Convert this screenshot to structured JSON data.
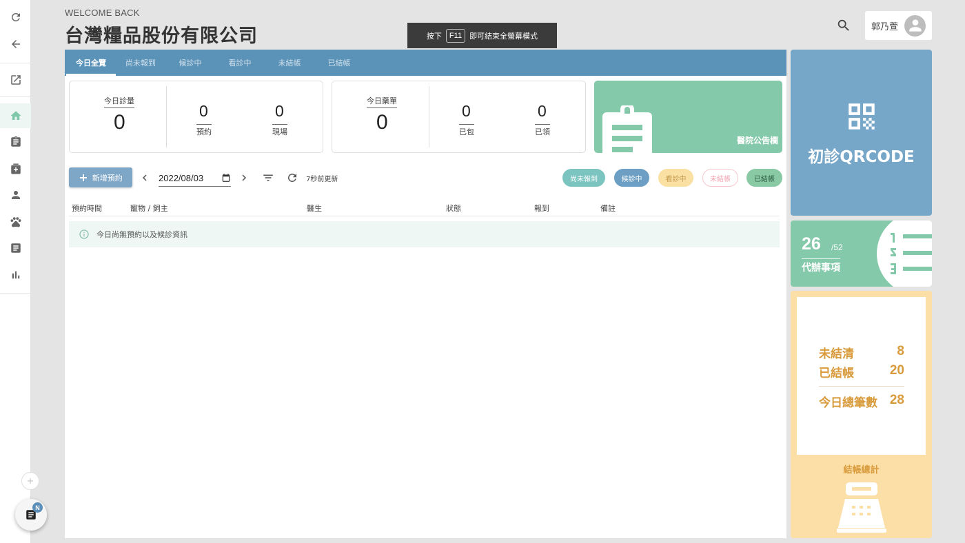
{
  "header": {
    "welcome": "WELCOME BACK",
    "company": "台灣糧品股份有限公司",
    "fullscreen_hint": {
      "before": "按下",
      "key": "F11",
      "after": "即可結束全螢幕模式"
    },
    "user_name": "郭乃萱"
  },
  "rail": {
    "icons": [
      "refresh-icon",
      "back-arrow-icon",
      "open-external-icon",
      "home-icon",
      "clipboard-icon",
      "add-record-icon",
      "person-icon",
      "paw-icon",
      "document-icon",
      "bar-chart-icon"
    ],
    "active": "home-icon",
    "fab_badge": "N"
  },
  "tabs": [
    {
      "label": "今日全覽",
      "active": true
    },
    {
      "label": "尚未報到",
      "active": false
    },
    {
      "label": "候診中",
      "active": false
    },
    {
      "label": "看診中",
      "active": false
    },
    {
      "label": "未結帳",
      "active": false
    },
    {
      "label": "已結帳",
      "active": false
    }
  ],
  "stats": {
    "visits": {
      "label": "今日診量",
      "value": "0",
      "booked_label": "預約",
      "booked": "0",
      "walkin_label": "現場",
      "walkin": "0"
    },
    "prescriptions": {
      "label": "今日藥單",
      "value": "0",
      "packed_label": "已包",
      "packed": "0",
      "picked_label": "已領",
      "picked": "0"
    }
  },
  "notice": {
    "label": "醫院公告欄"
  },
  "toolbar": {
    "add_label": "新增預約",
    "date": "2022/08/03",
    "refresh_text": "7秒前更新",
    "chips": [
      {
        "label": "尚未報到",
        "bg": "#7cc4c0",
        "color": "#ffffff",
        "border": "#7cc4c0"
      },
      {
        "label": "候診中",
        "bg": "#6c9fc3",
        "color": "#ffffff",
        "border": "#6c9fc3"
      },
      {
        "label": "看診中",
        "bg": "#fbe0a4",
        "color": "#c49a4c",
        "border": "#fbe0a4"
      },
      {
        "label": "未結帳",
        "bg": "#ffffff",
        "color": "#f2a6b1",
        "border": "#f5c8cf"
      },
      {
        "label": "已結帳",
        "bg": "#89c9a4",
        "color": "#2f5f45",
        "border": "#89c9a4"
      }
    ]
  },
  "table": {
    "columns": [
      "預約時間",
      "寵物 / 飼主",
      "醫生",
      "狀態",
      "報到",
      "備註"
    ],
    "empty_message": "今日尚無預約以及候診資訊"
  },
  "qr": {
    "label": "初診QRCODE"
  },
  "todo": {
    "count": "26",
    "total": "/52",
    "label": "代辦事項"
  },
  "billing": {
    "unsettled_label": "未結清",
    "unsettled": "8",
    "settled_label": "已結帳",
    "settled": "20",
    "total_label": "今日總筆數",
    "total": "28",
    "title": "結帳總計"
  },
  "colors": {
    "accent_blue": "#5b92b8",
    "accent_green": "#84c9aa",
    "accent_yellow": "#fbdfa6",
    "bill_text": "#d89a3a"
  }
}
